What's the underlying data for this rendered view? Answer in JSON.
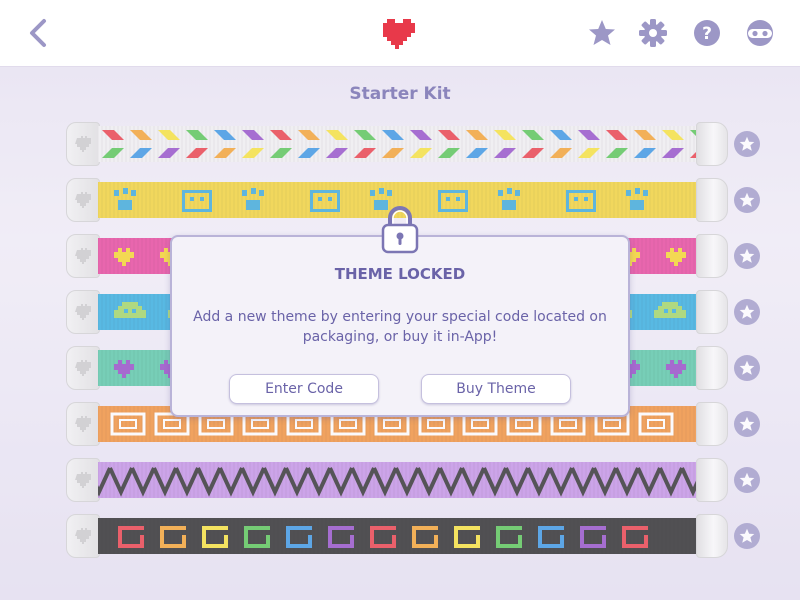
{
  "topbar": {
    "icons": [
      "back-icon",
      "heart-icon",
      "star-icon",
      "gear-icon",
      "help-icon",
      "mask-icon"
    ],
    "accent": "#e8394a",
    "icon_color": "#9c97c6"
  },
  "kit": {
    "title": "Starter Kit"
  },
  "bracelets": [
    {
      "pattern": "rainbow-chevrons",
      "base": "#f0f0f0"
    },
    {
      "pattern": "paws-and-faces",
      "base": "#f2d12a",
      "motif": "#2ea3d6"
    },
    {
      "pattern": "hearts",
      "base": "#e63a96",
      "motif": "#f4d21c"
    },
    {
      "pattern": "space-invaders",
      "base": "#26a8dc",
      "motif": "#9ad35a"
    },
    {
      "pattern": "hearts",
      "base": "#4fc5a2",
      "motif": "#8e3fc2"
    },
    {
      "pattern": "text-blocks",
      "base": "#f08a2c",
      "motif": "#ffffff"
    },
    {
      "pattern": "zigzag",
      "base": "#c18ce4",
      "motif": "#222222"
    },
    {
      "pattern": "rainbow-text",
      "base": "#1c1c1c"
    }
  ],
  "modal": {
    "title": "THEME LOCKED",
    "message": "Add a new theme by entering your special code located on packaging, or buy it in-App!",
    "enter_code_label": "Enter Code",
    "buy_theme_label": "Buy Theme"
  }
}
